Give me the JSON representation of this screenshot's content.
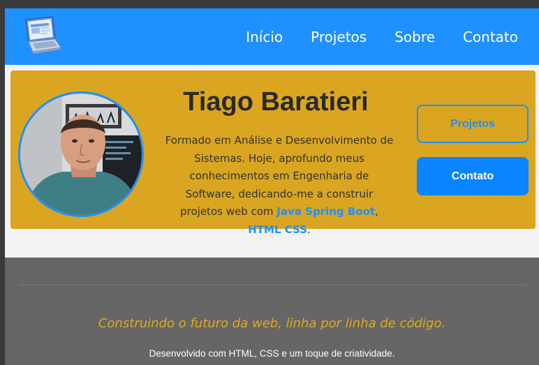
{
  "nav": {
    "items": [
      {
        "label": "Início"
      },
      {
        "label": "Projetos"
      },
      {
        "label": "Sobre"
      },
      {
        "label": "Contato"
      }
    ]
  },
  "hero": {
    "name": "Tiago Baratieri",
    "description": "Formado em Análise e Desenvolvimento de Sistemas. Hoje, aprofundo meus conhecimentos em Engenharia de Software, dedicando-me a construir projetos web com",
    "tech_links": [
      "Java Spring Boot",
      "HTML CSS"
    ],
    "separator": ",",
    "end_punct": ".",
    "buttons": {
      "projects": "Projetos",
      "contact": "Contato"
    }
  },
  "footer": {
    "tagline": "Construindo o futuro da web, linha por linha de código.",
    "credit": "Desenvolvido com HTML, CSS e um toque de criatividade."
  },
  "colors": {
    "navbar": "#1e90ff",
    "hero_bg": "#daa520",
    "accent": "#1e90ff",
    "footer_bg": "#666666",
    "tagline": "#e3a81e"
  },
  "icons": {
    "logo": "laptop-icon"
  }
}
